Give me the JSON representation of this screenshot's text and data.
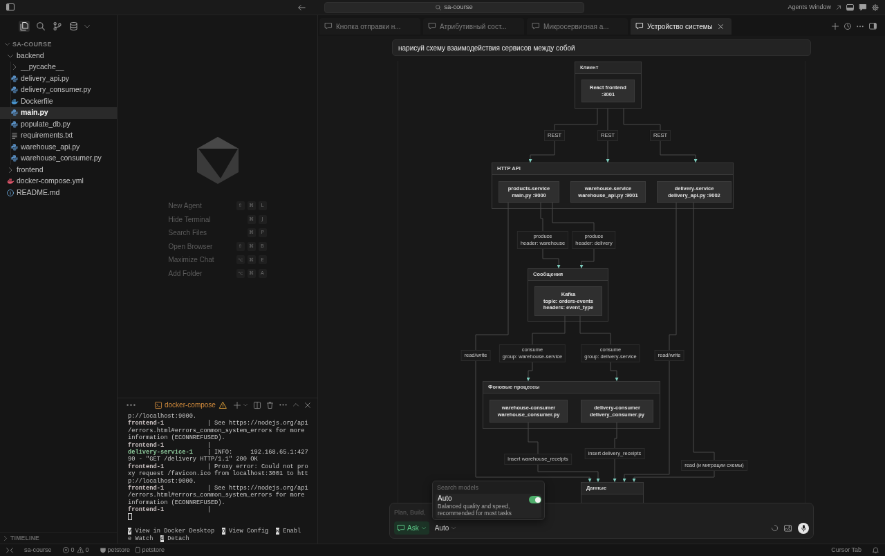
{
  "title_bar": {
    "search": "sa-course",
    "agents_window": "Agents Window"
  },
  "sidebar": {
    "views": [
      {
        "kind": "files",
        "selected": true
      },
      {
        "kind": "search",
        "selected": false
      },
      {
        "kind": "source_control",
        "selected": false
      },
      {
        "kind": "database",
        "selected": false
      }
    ],
    "explorer": {
      "title": "SA-COURSE",
      "expanded": true,
      "items": [
        {
          "label": "backend",
          "kind": "folder",
          "expanded": true,
          "selected": false,
          "children": [
            {
              "label": "__pycache__",
              "kind": "folder",
              "expanded": false,
              "selected": false
            },
            {
              "label": "delivery_api.py",
              "kind": "python",
              "selected": false
            },
            {
              "label": "delivery_consumer.py",
              "kind": "python",
              "selected": false
            },
            {
              "label": "Dockerfile",
              "kind": "docker",
              "selected": false
            },
            {
              "label": "main.py",
              "kind": "python",
              "selected": true
            },
            {
              "label": "populate_db.py",
              "kind": "python",
              "selected": false
            },
            {
              "label": "requirements.txt",
              "kind": "text",
              "selected": false
            },
            {
              "label": "warehouse_api.py",
              "kind": "python",
              "selected": false
            },
            {
              "label": "warehouse_consumer.py",
              "kind": "python",
              "selected": false
            }
          ]
        },
        {
          "label": "frontend",
          "kind": "folder",
          "expanded": false,
          "selected": false
        },
        {
          "label": "docker-compose.yml",
          "kind": "compose",
          "selected": false
        },
        {
          "label": "README.md",
          "kind": "info",
          "selected": false
        }
      ]
    },
    "timeline": {
      "title": "TIMELINE",
      "expanded": false
    }
  },
  "welcome": {
    "shortcuts": [
      {
        "label": "New Agent",
        "keys": [
          "⇧",
          "⌘",
          "L"
        ]
      },
      {
        "label": "Hide Terminal",
        "keys": [
          "⌘",
          "J"
        ]
      },
      {
        "label": "Search Files",
        "keys": [
          "⌘",
          "P"
        ]
      },
      {
        "label": "Open Browser",
        "keys": [
          "⇧",
          "⌘",
          "B"
        ]
      },
      {
        "label": "Maximize Chat",
        "keys": [
          "⌥",
          "⌘",
          "E"
        ]
      },
      {
        "label": "Add Folder",
        "keys": [
          "⌥",
          "⌘",
          "A"
        ]
      }
    ]
  },
  "terminal": {
    "title": "docker-compose",
    "lines": [
      {
        "text": "p://localhost:9000."
      },
      {
        "service": "frontend-1",
        "color": "#cdc4c4",
        "text": "| See https://nodejs.org/api"
      },
      {
        "text": "/errors.html#errors_common_system_errors for more"
      },
      {
        "text": "information (ECONNREFUSED)."
      },
      {
        "service": "frontend-1",
        "color": "#cdc4c4",
        "text": "|"
      },
      {
        "service": "delivery-service-1",
        "color": "#8cc79a",
        "text": "| INFO:     192.168.65.1:427"
      },
      {
        "text": "90 - \"GET /delivery HTTP/1.1\" 200 OK"
      },
      {
        "service": "frontend-1",
        "color": "#cdc4c4",
        "text": "| Proxy error: Could not pro"
      },
      {
        "text": "xy request /favicon.ico from localhost:3001 to htt"
      },
      {
        "text": "p://localhost:9000."
      },
      {
        "service": "frontend-1",
        "color": "#cdc4c4",
        "text": "| See https://nodejs.org/api"
      },
      {
        "text": "/errors.html#errors_common_system_errors for more"
      },
      {
        "text": "information (ECONNREFUSED)."
      },
      {
        "service": "frontend-1",
        "color": "#cdc4c4",
        "text": "|"
      }
    ],
    "hints": [
      [
        {
          "key": "v",
          "text": "View in Docker Desktop"
        },
        {
          "key": "o",
          "text": "View Config"
        },
        {
          "key": "w",
          "text": "Enabl"
        }
      ],
      [
        {
          "text": "e Watch"
        },
        {
          "key": "d",
          "text": "Detach"
        }
      ]
    ]
  },
  "chat": {
    "tabs": [
      {
        "title": "Кнопка отправки н...",
        "selected": false
      },
      {
        "title": "Атрибутивный сост...",
        "selected": false
      },
      {
        "title": "Микросервисная а...",
        "selected": false
      },
      {
        "title": "Устройство системы",
        "selected": true
      }
    ],
    "prompt": "нарисуй схему взаимодействия сервисов между собой",
    "diagram": {
      "groups": [
        {
          "title": "Клиент",
          "nodes": [
            {
              "lines": [
                "React frontend",
                ":3001"
              ]
            }
          ]
        },
        {
          "title": "HTTP API",
          "nodes": [
            {
              "lines": [
                "products-service",
                "main.py :9000"
              ]
            },
            {
              "lines": [
                "warehouse-service",
                "warehouse_api.py :9001"
              ]
            },
            {
              "lines": [
                "delivery-service",
                "delivery_api.py :9002"
              ]
            }
          ]
        },
        {
          "title": "Сообщения",
          "nodes": [
            {
              "lines": [
                "Kafka",
                "topic: orders-events",
                "headers: event_type"
              ]
            }
          ]
        },
        {
          "title": "Фоновые процессы",
          "nodes": [
            {
              "lines": [
                "warehouse-consumer",
                "warehouse_consumer.py"
              ]
            },
            {
              "lines": [
                "delivery-consumer",
                "delivery_consumer.py"
              ]
            }
          ]
        },
        {
          "title": "Данные"
        }
      ],
      "edge_labels": [
        {
          "lines": [
            "REST"
          ]
        },
        {
          "lines": [
            "REST"
          ]
        },
        {
          "lines": [
            "REST"
          ]
        },
        {
          "lines": [
            "produce",
            "header: warehouse"
          ]
        },
        {
          "lines": [
            "produce",
            "header: delivery"
          ]
        },
        {
          "lines": [
            "read/write"
          ]
        },
        {
          "lines": [
            "consume",
            "group: warehouse-service"
          ]
        },
        {
          "lines": [
            "consume",
            "group: delivery-service"
          ]
        },
        {
          "lines": [
            "read/write"
          ]
        },
        {
          "lines": [
            "insert warehouse_receipts"
          ]
        },
        {
          "lines": [
            "insert delivery_receipts"
          ]
        },
        {
          "lines": [
            "read (и миграции схемы)"
          ]
        }
      ]
    },
    "input": {
      "placeholder": "Plan, Build,",
      "mode": "Ask",
      "model": "Auto"
    },
    "model_picker": {
      "search_placeholder": "Search models",
      "items": [
        {
          "name": "Auto",
          "description": "Balanced quality and speed, recommended for most tasks",
          "on": true
        }
      ]
    }
  },
  "status_bar": {
    "workspace": "sa-course",
    "errors": "0",
    "warnings": "0",
    "items": [
      {
        "kind": "shield",
        "label": "petstore"
      },
      {
        "kind": "document",
        "label": "petstore"
      }
    ],
    "right": "Cursor Tab"
  }
}
